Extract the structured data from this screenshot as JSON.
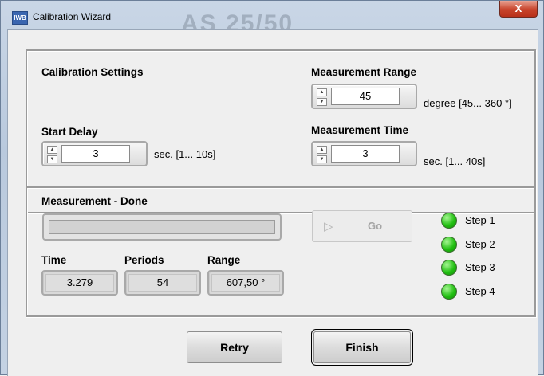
{
  "window": {
    "title": "Calibration Wizard",
    "app_icon_text": "IWB",
    "background_text": "AS 25/50",
    "close_glyph": "X"
  },
  "settings": {
    "heading": "Calibration Settings",
    "start_delay": {
      "label": "Start Delay",
      "value": "3",
      "unit": "sec. [1... 10s]"
    },
    "measurement_range": {
      "label": "Measurement Range",
      "value": "45",
      "unit": "degree [45... 360 °]"
    },
    "measurement_time": {
      "label": "Measurement Time",
      "value": "3",
      "unit": "sec. [1... 40s]"
    }
  },
  "measurement": {
    "status_label": "Measurement - Done",
    "progress_fraction": 0,
    "go_label": "Go",
    "time": {
      "label": "Time",
      "value": "3.279"
    },
    "periods": {
      "label": "Periods",
      "value": "54"
    },
    "range": {
      "label": "Range",
      "value": "607,50 °"
    }
  },
  "steps": [
    {
      "label": "Step 1",
      "color": "#22c012"
    },
    {
      "label": "Step 2",
      "color": "#22c012"
    },
    {
      "label": "Step 3",
      "color": "#22c012"
    },
    {
      "label": "Step 4",
      "color": "#22c012"
    }
  ],
  "buttons": {
    "retry": "Retry",
    "finish": "Finish"
  }
}
